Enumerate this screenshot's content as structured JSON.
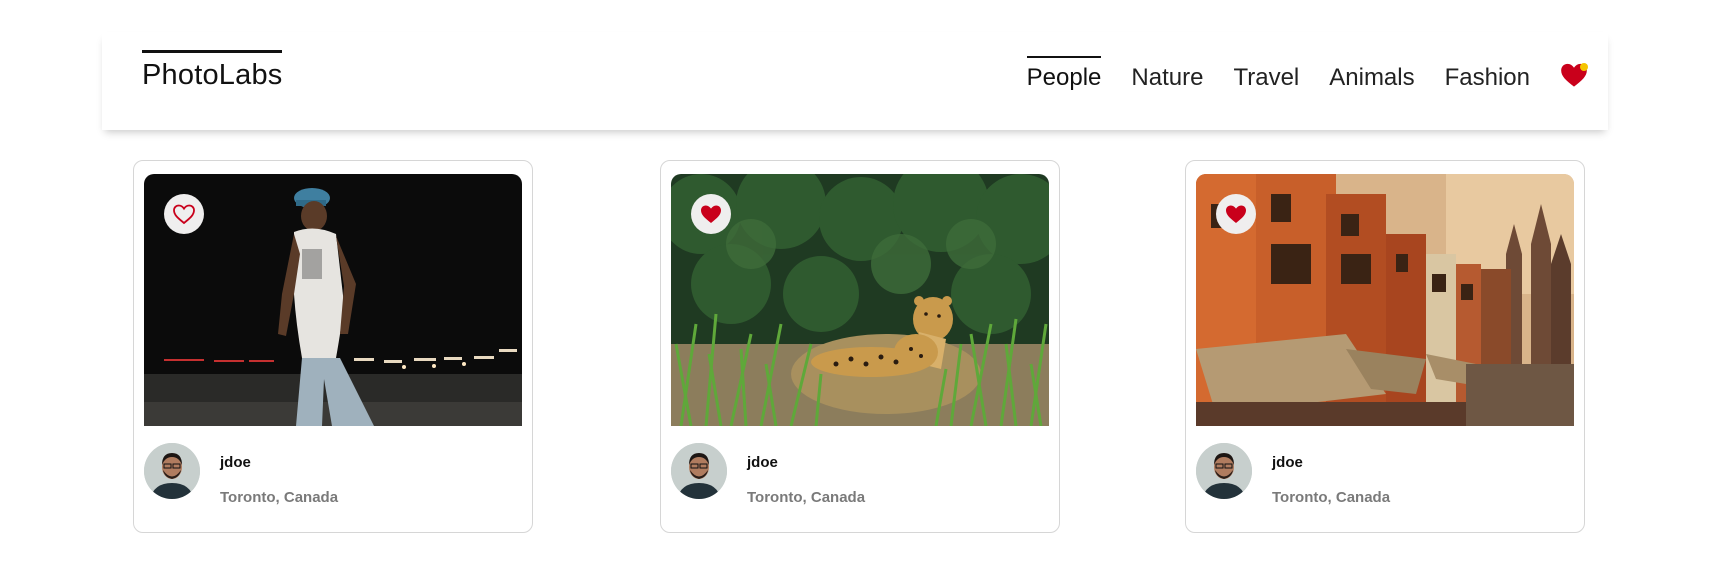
{
  "app": {
    "logo": "PhotoLabs"
  },
  "nav": {
    "topics": [
      {
        "label": "People",
        "active": true
      },
      {
        "label": "Nature",
        "active": false
      },
      {
        "label": "Travel",
        "active": false
      },
      {
        "label": "Animals",
        "active": false
      },
      {
        "label": "Fashion",
        "active": false
      }
    ],
    "fav_icon": "heart-icon",
    "fav_has_notification": true
  },
  "colors": {
    "heart": "#c9001b",
    "notify_dot": "#f5c400",
    "like_bg": "#efeeee",
    "location": "#7a7a7a"
  },
  "photos": [
    {
      "subject": "man-walking-at-night",
      "liked": false,
      "username": "jdoe",
      "location": "Toronto, Canada"
    },
    {
      "subject": "jaguar-in-grass",
      "liked": true,
      "username": "jdoe",
      "location": "Toronto, Canada"
    },
    {
      "subject": "orange-buildings-street",
      "liked": true,
      "username": "jdoe",
      "location": "Toronto, Canada"
    }
  ]
}
